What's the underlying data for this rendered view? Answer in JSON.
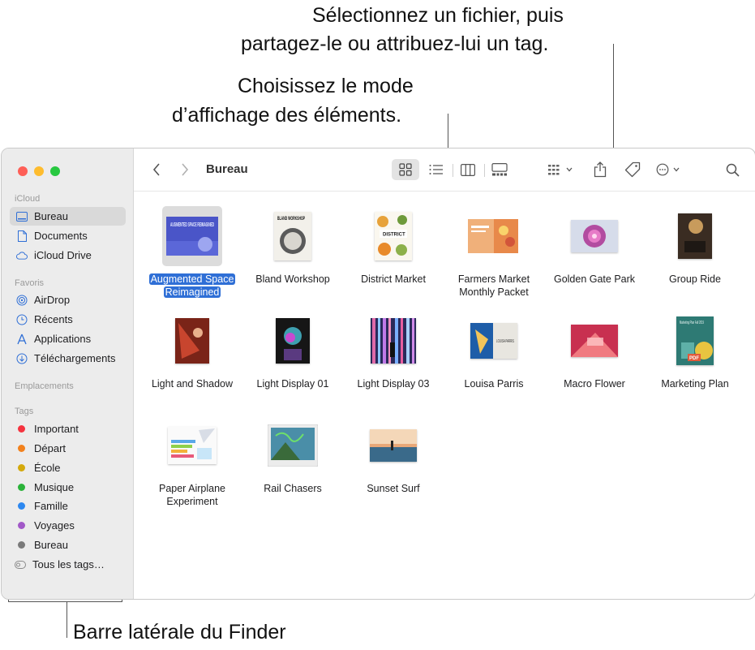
{
  "annotations": {
    "share_tag_line1": "Sélectionnez un fichier, puis",
    "share_tag_line2": "partagez-le ou attribuez-lui un tag.",
    "view_mode_line1": "Choisissez le mode",
    "view_mode_line2": "d’affichage des éléments.",
    "sidebar": "Barre latérale du Finder"
  },
  "sidebar": {
    "sections": {
      "icloud": "iCloud",
      "favorites": "Favoris",
      "locations": "Emplacements",
      "tags": "Tags"
    },
    "icloud_items": [
      {
        "label": "Bureau",
        "icon": "desktop-icon",
        "selected": true
      },
      {
        "label": "Documents",
        "icon": "document-icon"
      },
      {
        "label": "iCloud Drive",
        "icon": "cloud-icon"
      }
    ],
    "favorite_items": [
      {
        "label": "AirDrop",
        "icon": "airdrop-icon"
      },
      {
        "label": "Récents",
        "icon": "clock-icon"
      },
      {
        "label": "Applications",
        "icon": "applications-icon"
      },
      {
        "label": "Téléchargements",
        "icon": "download-icon"
      }
    ],
    "tag_items": [
      {
        "label": "Important",
        "color": "#f5333f"
      },
      {
        "label": "Départ",
        "color": "#f2811d"
      },
      {
        "label": "École",
        "color": "#d4a90c"
      },
      {
        "label": "Musique",
        "color": "#2bb33a"
      },
      {
        "label": "Famille",
        "color": "#2d88f0"
      },
      {
        "label": "Voyages",
        "color": "#a259c8"
      },
      {
        "label": "Bureau",
        "color": "#7a7a7a"
      }
    ],
    "all_tags": "Tous les tags…"
  },
  "toolbar": {
    "title": "Bureau",
    "icons": [
      "chevron-left-icon",
      "chevron-right-icon",
      "icon-view-icon",
      "list-view-icon",
      "column-view-icon",
      "gallery-view-icon",
      "group-icon",
      "share-icon",
      "tag-icon",
      "more-icon",
      "search-icon"
    ]
  },
  "files": [
    {
      "name": "Augmented Space Reimagined",
      "selected": true
    },
    {
      "name": "Bland Workshop"
    },
    {
      "name": "District Market"
    },
    {
      "name": "Farmers Market Monthly Packet"
    },
    {
      "name": "Golden Gate Park"
    },
    {
      "name": "Group Ride"
    },
    {
      "name": "Light and Shadow"
    },
    {
      "name": "Light Display 01"
    },
    {
      "name": "Light Display 03"
    },
    {
      "name": "Louisa Parris"
    },
    {
      "name": "Macro Flower"
    },
    {
      "name": "Marketing Plan"
    },
    {
      "name": "Paper Airplane Experiment"
    },
    {
      "name": "Rail Chasers"
    },
    {
      "name": "Sunset Surf"
    }
  ],
  "thumbnail_text": {
    "augmented": "AUGMENTED SPACE REIMAGINED",
    "bland": "BLAND WORKSHOP",
    "district": "DISTRICT",
    "louisa": "LOUISA PARRIS",
    "marketing_plan": "Marketing Plan Fall 2019",
    "marketing_badge": "PDF"
  },
  "colors": {
    "selection": "#2f6fd6",
    "close": "#fe5f57",
    "minimize": "#febc2e",
    "zoom": "#28c840"
  }
}
